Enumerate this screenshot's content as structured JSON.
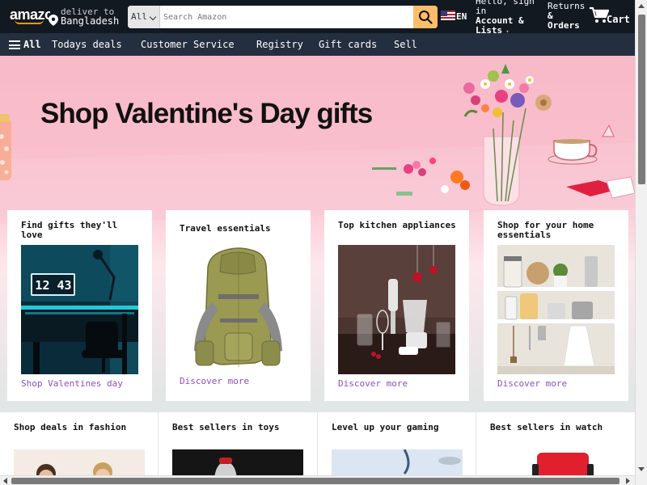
{
  "header": {
    "logo_text": "amazon",
    "deliver_line1": "deliver to",
    "deliver_line2": "Bangladesh",
    "search_category": "All",
    "search_placeholder": "Search Amazon",
    "language": "EN",
    "account_line1": "Hello, sign in",
    "account_line2": "Account & Lists",
    "returns_line1": "Returns",
    "returns_line2": "& Orders",
    "cart_label": "Cart"
  },
  "subnav": {
    "all_label": "All",
    "items": [
      "Todays deals",
      "Customer Service",
      "Registry",
      "Gift cards",
      "Sell"
    ]
  },
  "hero": {
    "title": "Shop Valentine's Day gifts"
  },
  "cards_row1": [
    {
      "title": "Find gifts they'll love",
      "link": "Shop Valentines day"
    },
    {
      "title": "Travel essentials",
      "link": "Discover more"
    },
    {
      "title": "Top kitchen appliances",
      "link": "Discover more"
    },
    {
      "title": "Shop for your home essentials",
      "link": "Discover more"
    }
  ],
  "cards_row2": [
    {
      "title": "Shop deals in fashion"
    },
    {
      "title": "Best sellers in toys"
    },
    {
      "title": "Level up your gaming"
    },
    {
      "title": "Best sellers in watch"
    }
  ],
  "desk_clock": "12 43",
  "colors": {
    "nav_bg": "#131921",
    "subnav_bg": "#232f3e",
    "search_button": "#febd69",
    "link": "#8a4fbf",
    "hero_pink": "#f8b9c8"
  }
}
